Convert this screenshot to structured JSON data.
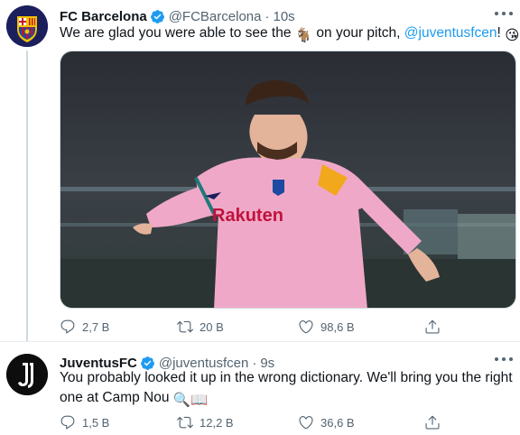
{
  "tweets": [
    {
      "author": "FC Barcelona",
      "handle": "@FCBarcelona",
      "separator": "·",
      "time": "10s",
      "text_before": "We are glad you were able to see the ",
      "text_emoji": "🐐",
      "text_middle": " on your pitch, ",
      "mention": "@juventusfcen",
      "text_after": "! ",
      "text_end_emoji": "😘",
      "media_text": "Rakuten",
      "stats": {
        "replies": "2,7 B",
        "retweets": "20 B",
        "likes": "98,6 B"
      }
    },
    {
      "author": "JuventusFC",
      "handle": "@juventusfcen",
      "separator": "·",
      "time": "9s",
      "line1": "You probably looked it up in the wrong dictionary. We'll bring you the right",
      "line2": "one at Camp Nou ",
      "line2_emoji": "🔍📖",
      "stats": {
        "replies": "1,5 B",
        "retweets": "12,2 B",
        "likes": "36,6 B"
      }
    }
  ],
  "colors": {
    "accent": "#1d9bf0",
    "muted": "#536471",
    "shirt": "#f0a8c8",
    "barca_blue": "#1b1f5c"
  },
  "icons": [
    "verified-icon",
    "more-icon",
    "reply-icon",
    "retweet-icon",
    "like-icon",
    "share-icon"
  ]
}
